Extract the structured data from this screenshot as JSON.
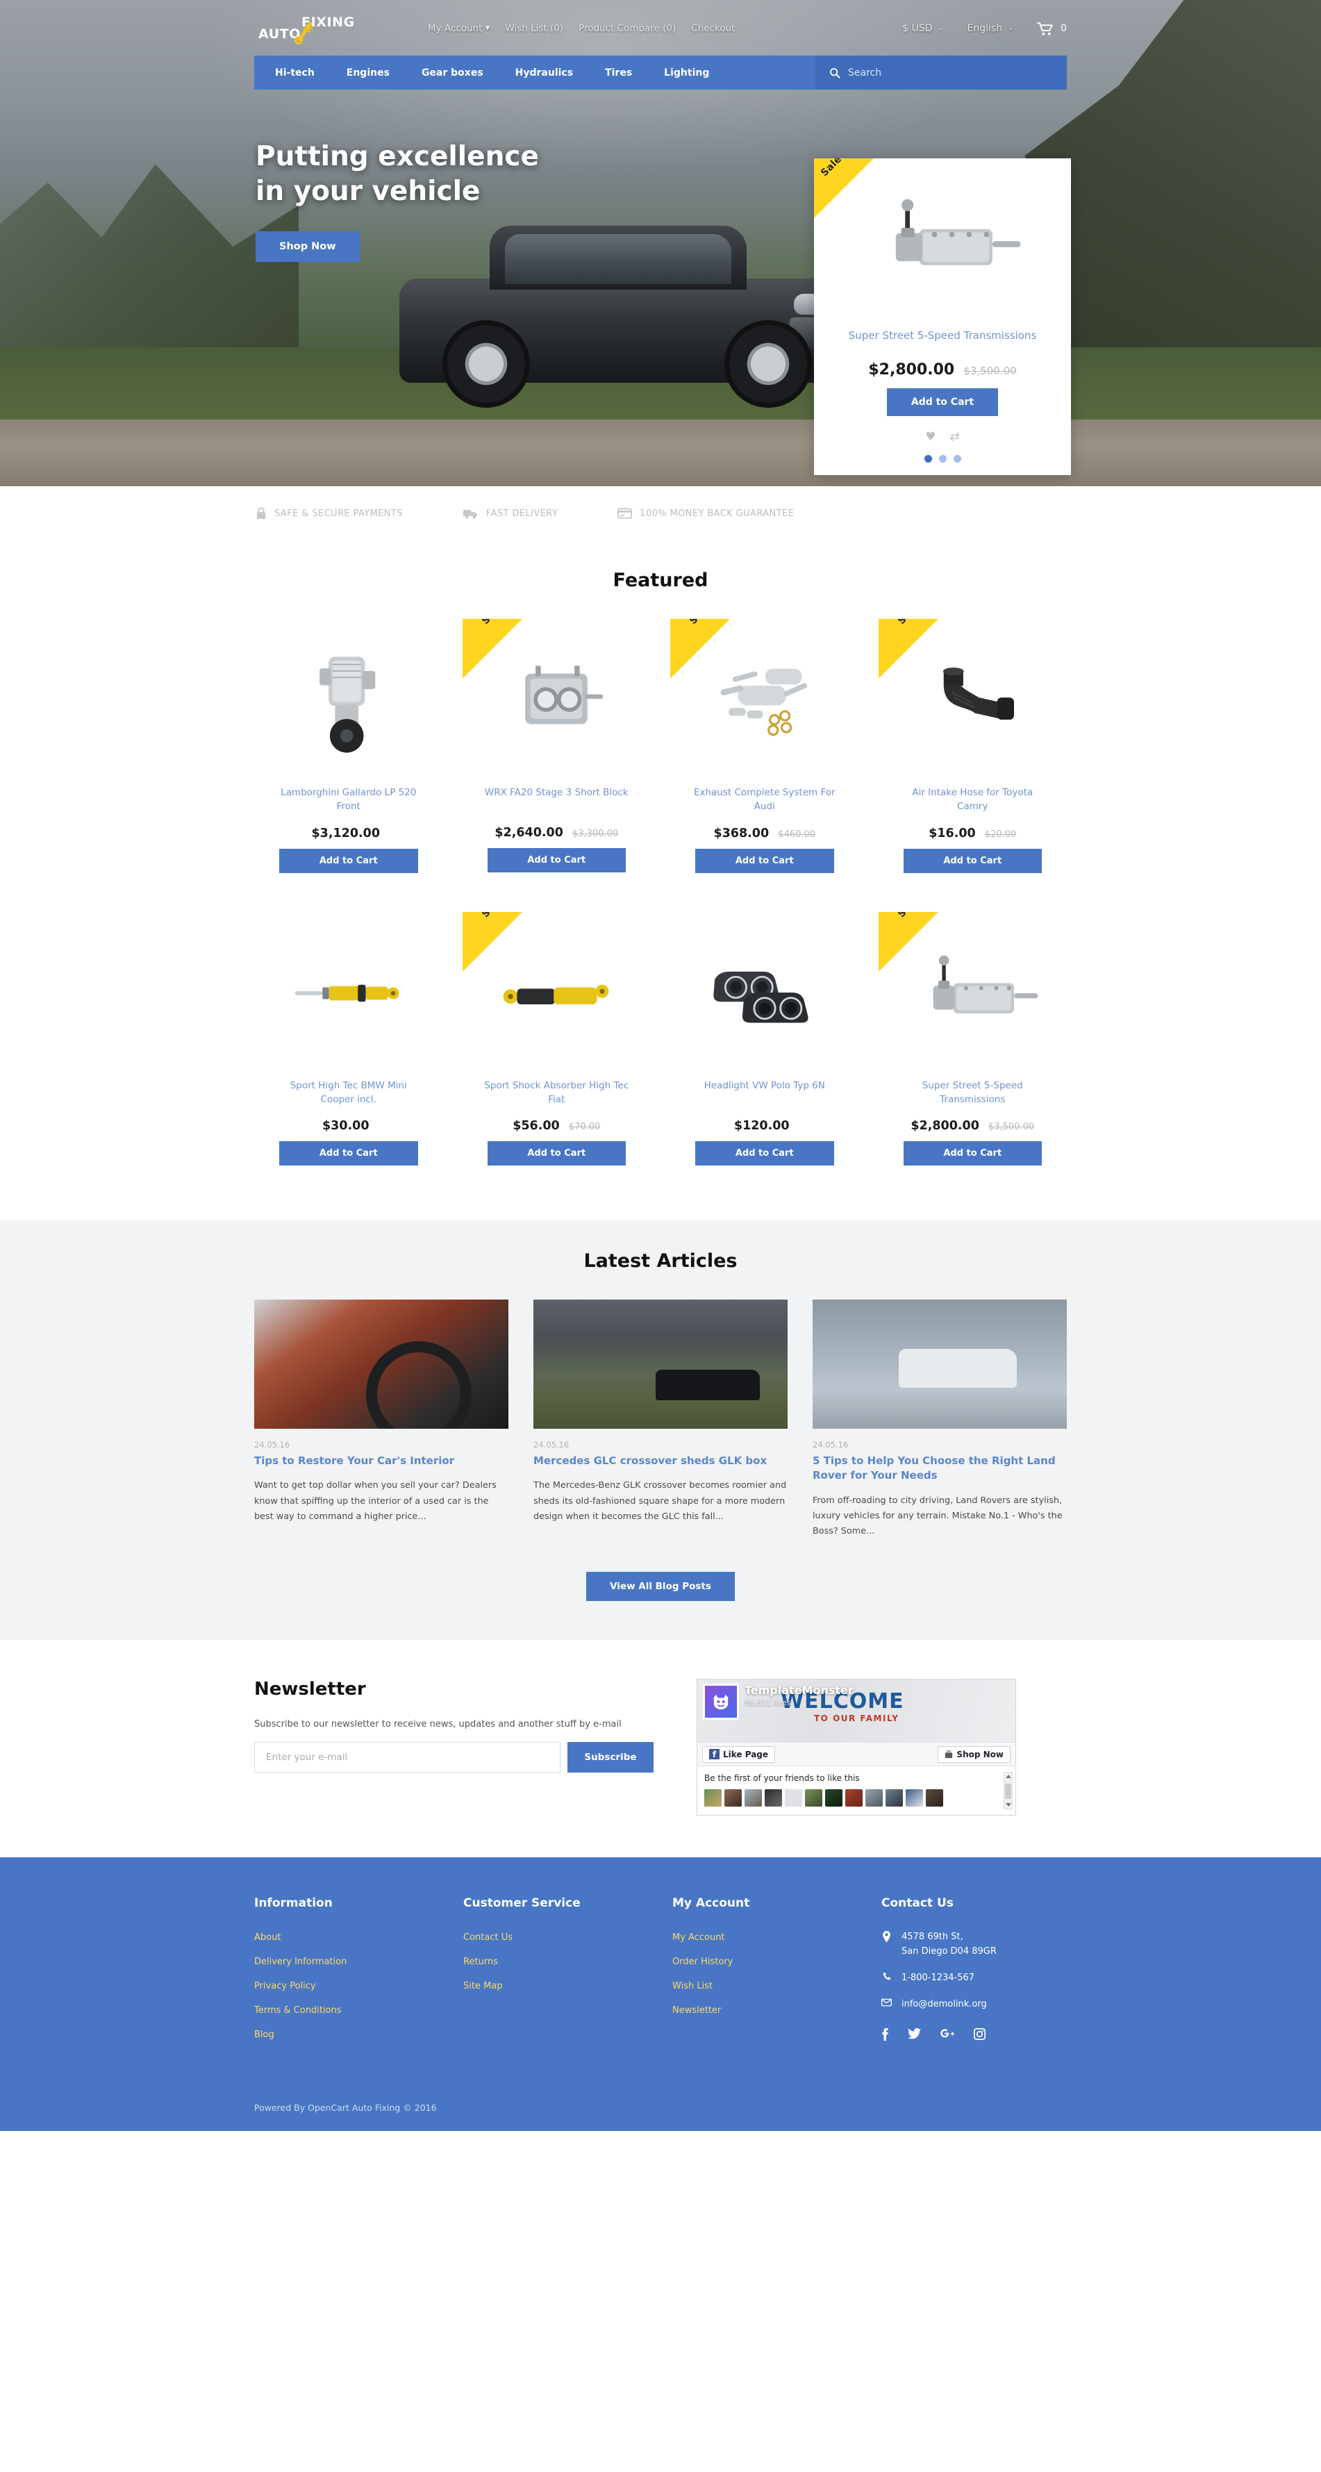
{
  "header": {
    "logo_auto": "AUTO",
    "logo_fixing": "FIXING",
    "top_links": [
      {
        "label": "My Account",
        "has_caret": true
      },
      {
        "label": "Wish List (0)",
        "has_caret": false
      },
      {
        "label": "Product Compare (0)",
        "has_caret": false
      },
      {
        "label": "Checkout",
        "has_caret": false
      }
    ],
    "currency": "$ USD",
    "language": "English",
    "cart_count": "0",
    "nav": [
      "Hi-tech",
      "Engines",
      "Gear boxes",
      "Hydraulics",
      "Tires",
      "Lighting"
    ],
    "search_placeholder": "Search"
  },
  "hero": {
    "title_line1": "Putting excellence",
    "title_line2": "in your vehicle",
    "cta": "Shop Now",
    "card": {
      "badge": "Sale",
      "name": "Super Street 5-Speed Transmissions",
      "price_new": "$2,800.00",
      "price_old": "$3,500.00",
      "add_to_cart": "Add to Cart",
      "dots": 3,
      "active_dot": 0
    }
  },
  "trust": [
    {
      "icon": "lock-icon",
      "label": "SAFE & SECURE PAYMENTS"
    },
    {
      "icon": "truck-icon",
      "label": "FAST DELIVERY"
    },
    {
      "icon": "card-icon",
      "label": "100% MONEY BACK GUARANTEE"
    }
  ],
  "featured": {
    "title": "Featured",
    "add_to_cart": "Add to Cart",
    "badge": "Sale",
    "products": [
      {
        "name": "Lamborghini Gallardo LP 520 Front",
        "price_new": "$3,120.00",
        "price_old": "",
        "sale": false,
        "img": "supercharger"
      },
      {
        "name": "WRX FA20 Stage 3 Short Block",
        "price_new": "$2,640.00",
        "price_old": "$3,300.00",
        "sale": true,
        "img": "shortblock"
      },
      {
        "name": "Exhaust Complete System For Audi",
        "price_new": "$368.00",
        "price_old": "$460.00",
        "sale": true,
        "img": "exhaust"
      },
      {
        "name": "Air Intake Hose for Toyota Camry",
        "price_new": "$16.00",
        "price_old": "$20.00",
        "sale": true,
        "img": "hose"
      },
      {
        "name": "Sport High Tec BMW Mini Cooper incl.",
        "price_new": "$30.00",
        "price_old": "",
        "sale": false,
        "img": "strut"
      },
      {
        "name": "Sport Shock Absorber High Tec Fiat",
        "price_new": "$56.00",
        "price_old": "$70.00",
        "sale": true,
        "img": "shock"
      },
      {
        "name": "Headlight VW Polo Typ 6N",
        "price_new": "$120.00",
        "price_old": "",
        "sale": false,
        "img": "headlight"
      },
      {
        "name": "Super Street 5-Speed Transmissions",
        "price_new": "$2,800.00",
        "price_old": "$3,500.00",
        "sale": true,
        "img": "transmission"
      }
    ]
  },
  "articles": {
    "title": "Latest Articles",
    "view_all": "View All Blog Posts",
    "items": [
      {
        "date": "24.05.16",
        "title": "Tips to Restore Your Car's Interior",
        "text": "Want to get top dollar when you sell your car? Dealers know that spiffing up the interior of a used car is the best way to command a higher price..."
      },
      {
        "date": "24.05.16",
        "title": "Mercedes GLC crossover sheds GLK box",
        "text": "The Mercedes-Benz GLK crossover becomes roomier and sheds its old-fashioned square shape for a more modern design when it becomes the GLC this fall..."
      },
      {
        "date": "24.05.16",
        "title": "5 Tips to Help You Choose the Right Land Rover for Your Needs",
        "text": "From off-roading to city driving, Land Rovers are stylish, luxury vehicles for any terrain. Mistake No.1 - Who's the Boss? Some..."
      }
    ]
  },
  "newsletter": {
    "title": "Newsletter",
    "subtitle": "Subscribe to our newsletter to receive news, updates and another stuff by e-mail",
    "input_placeholder": "Enter your e-mail",
    "input_value": "",
    "button": "Subscribe"
  },
  "facebook": {
    "page_name": "TemplateMonster",
    "likes": "86,611 likes",
    "cover_welcome": "WELCOME",
    "cover_family": "TO OUR FAMILY",
    "like_button": "Like Page",
    "shop_button": "Shop Now",
    "first_text": "Be the first of your friends to like this"
  },
  "footer": {
    "columns": [
      {
        "heading": "Information",
        "links": [
          "About",
          "Delivery Information",
          "Privacy Policy",
          "Terms & Conditions",
          "Blog"
        ]
      },
      {
        "heading": "Customer Service",
        "links": [
          "Contact Us",
          "Returns",
          "Site Map"
        ]
      },
      {
        "heading": "My Account",
        "links": [
          "My Account",
          "Order History",
          "Wish List",
          "Newsletter"
        ]
      }
    ],
    "contact_heading": "Contact Us",
    "address_line1": "4578 69th St,",
    "address_line2": "San Diego D04 89GR",
    "phone": "1-800-1234-567",
    "email": "info@demolink.org",
    "socials": [
      "facebook-icon",
      "twitter-icon",
      "google-plus-icon",
      "instagram-icon"
    ],
    "copyright": "Powered By OpenCart Auto Fixing © 2016"
  },
  "colors": {
    "brand_blue": "#4876c4",
    "link_blue": "#6e93d0",
    "sale_yellow": "#ffd520",
    "footer_link": "#ffd966"
  }
}
